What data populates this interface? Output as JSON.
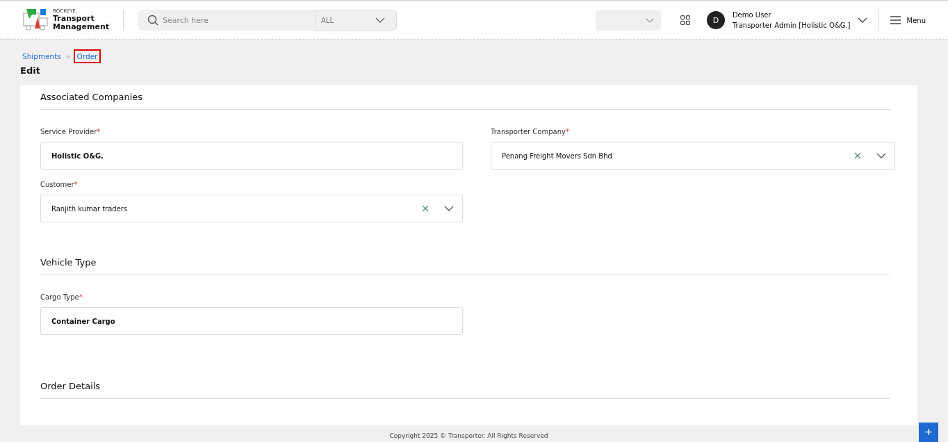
{
  "header": {
    "brand_small": "ROCKEYE",
    "brand_line1": "Transport",
    "brand_line2": "Management",
    "search": {
      "placeholder": "Search here"
    },
    "scope_select": "ALL",
    "user": {
      "initial": "D",
      "name": "Demo User",
      "role": "Transporter Admin [Holistic O&G.]"
    },
    "menu_label": "Menu"
  },
  "breadcrumb": [
    {
      "label": "Shipments",
      "highlighted": false
    },
    {
      "label": "Order",
      "highlighted": true
    }
  ],
  "breadcrumb_separator": "»",
  "page_title": "Edit",
  "sections": [
    {
      "title": "Associated Companies",
      "fields": [
        {
          "label": "Service Provider",
          "required": true,
          "kind": "text",
          "value": "Holistic O&G."
        },
        {
          "label": "Transporter Company",
          "required": true,
          "kind": "select",
          "value": "Penang Freight Movers Sdn Bhd"
        },
        {
          "label": "Customer",
          "required": true,
          "kind": "select",
          "value": "Ranjith kumar traders"
        }
      ]
    },
    {
      "title": "Vehicle Type",
      "fields": [
        {
          "label": "Cargo Type",
          "required": true,
          "kind": "text",
          "value": "Container Cargo"
        }
      ]
    },
    {
      "title": "Order Details"
    }
  ],
  "required_mark": "*",
  "footer": "Copyright 2025 © Transporter. All Rights Reserved",
  "fab": "+"
}
